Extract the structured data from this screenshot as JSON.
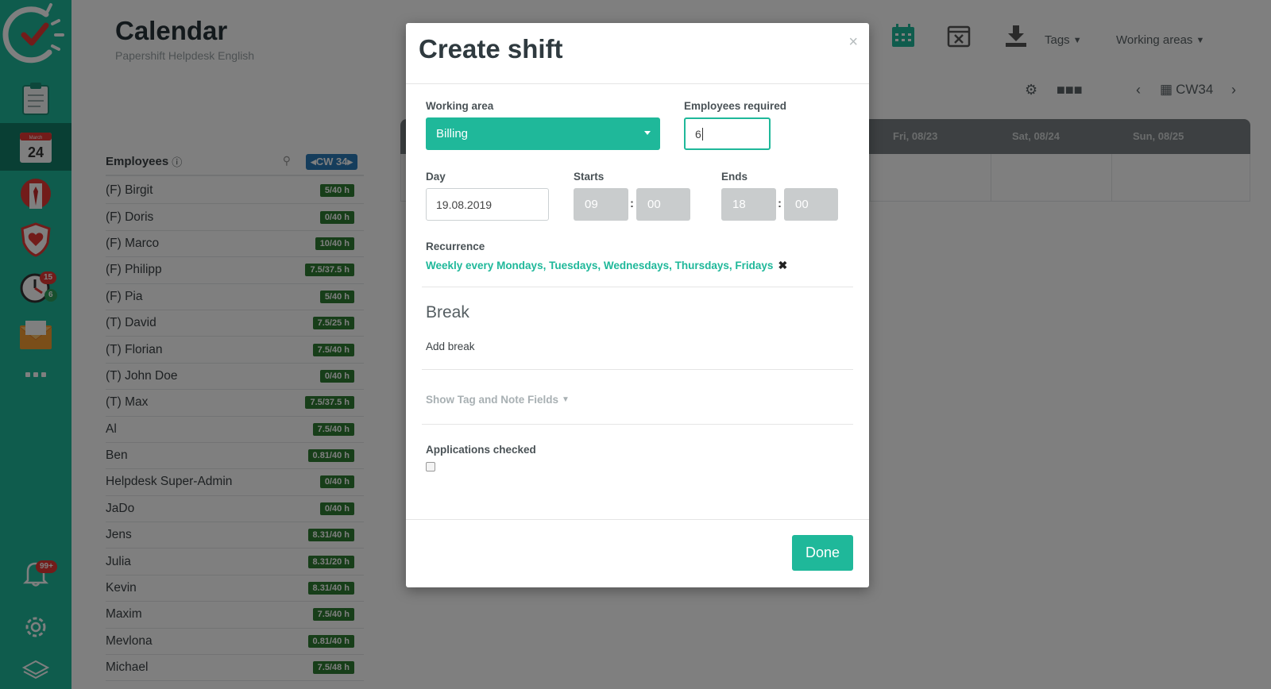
{
  "sidebar": {
    "items": [
      {
        "name": "clipboard",
        "label": ""
      },
      {
        "name": "calendar",
        "label": "24",
        "month": "March"
      },
      {
        "name": "employee",
        "label": ""
      },
      {
        "name": "shield",
        "label": ""
      },
      {
        "name": "clock",
        "label": ""
      },
      {
        "name": "mail",
        "label": ""
      },
      {
        "name": "more",
        "label": ""
      }
    ],
    "clock_badge_red": "15",
    "clock_badge_green": "6",
    "bell_badge": "99+"
  },
  "header": {
    "title": "Calendar",
    "subtitle": "Papershift Helpdesk English",
    "tags_label": "Tags",
    "working_areas_label": "Working areas",
    "week_label": "CW34"
  },
  "employees": {
    "title": "Employees",
    "week_button": "CW 34",
    "rows": [
      {
        "name": "(F) Birgit",
        "hours": "5/40 h"
      },
      {
        "name": "(F) Doris",
        "hours": "0/40 h"
      },
      {
        "name": "(F) Marco",
        "hours": "10/40 h"
      },
      {
        "name": "(F) Philipp",
        "hours": "7.5/37.5 h"
      },
      {
        "name": "(F) Pia",
        "hours": "5/40 h"
      },
      {
        "name": "(T) David",
        "hours": "7.5/25 h"
      },
      {
        "name": "(T) Florian",
        "hours": "7.5/40 h"
      },
      {
        "name": "(T) John Doe",
        "hours": "0/40 h"
      },
      {
        "name": "(T) Max",
        "hours": "7.5/37.5 h"
      },
      {
        "name": "Al",
        "hours": "7.5/40 h"
      },
      {
        "name": "Ben",
        "hours": "0.81/40 h"
      },
      {
        "name": "Helpdesk Super-Admin",
        "hours": "0/40 h"
      },
      {
        "name": "JaDo",
        "hours": "0/40 h"
      },
      {
        "name": "Jens",
        "hours": "8.31/40 h"
      },
      {
        "name": "Julia",
        "hours": "8.31/20 h"
      },
      {
        "name": "Kevin",
        "hours": "8.31/40 h"
      },
      {
        "name": "Maxim",
        "hours": "7.5/40 h"
      },
      {
        "name": "Mevlona",
        "hours": "0.81/40 h"
      },
      {
        "name": "Michael",
        "hours": "7.5/48 h"
      }
    ]
  },
  "calendar": {
    "days": [
      "Fri, 08/23",
      "Sat, 08/24",
      "Sun, 08/25"
    ]
  },
  "modal": {
    "title": "Create shift",
    "close": "×",
    "working_area_label": "Working area",
    "working_area_value": "Billing",
    "employees_required_label": "Employees required",
    "employees_required_value": "6",
    "day_label": "Day",
    "day_value": "19.08.2019",
    "starts_label": "Starts",
    "starts_hour": "09",
    "starts_min": "00",
    "ends_label": "Ends",
    "ends_hour": "18",
    "ends_min": "00",
    "recurrence_label": "Recurrence",
    "recurrence_value": "Weekly every Mondays, Tuesdays, Wednesdays, Thursdays, Fridays",
    "break_title": "Break",
    "add_break": "Add break",
    "show_tags": "Show Tag and Note Fields",
    "applications_checked_label": "Applications checked",
    "done": "Done"
  },
  "colors": {
    "brand": "#1fb89a",
    "sidebar_active": "#127e69",
    "hours_badge": "#2e7d32",
    "week_button": "#2b7bb9"
  }
}
